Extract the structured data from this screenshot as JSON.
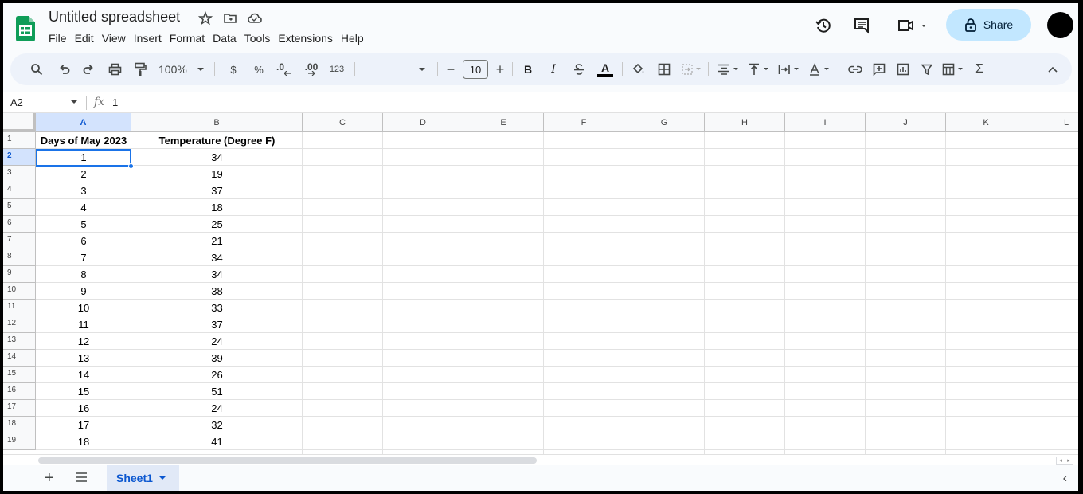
{
  "app": {
    "doc_title": "Untitled spreadsheet",
    "menu": [
      "File",
      "Edit",
      "View",
      "Insert",
      "Format",
      "Data",
      "Tools",
      "Extensions",
      "Help"
    ],
    "share_label": "Share",
    "accent_color": "#0b57d0",
    "share_bg": "#c2e7ff"
  },
  "toolbar": {
    "zoom": "100%",
    "currency": "$",
    "percent": "%",
    "decrease_decimal": ".0",
    "increase_decimal": ".00",
    "more_formats": "123",
    "font_size": "10",
    "minus": "−",
    "plus": "+",
    "bold": "B",
    "italic": "I",
    "text_color_letter": "A",
    "function": "Σ",
    "collapse": "^"
  },
  "formula_bar": {
    "cell_ref": "A2",
    "fx": "fx",
    "content": "1"
  },
  "grid": {
    "columns": [
      "A",
      "B",
      "C",
      "D",
      "E",
      "F",
      "G",
      "H",
      "I",
      "J",
      "K",
      "L"
    ],
    "selected_column": "A",
    "selected_row": "2",
    "row_numbers": [
      "1",
      "2",
      "3",
      "4",
      "5",
      "6",
      "7",
      "8",
      "9",
      "10",
      "11",
      "12",
      "13",
      "14",
      "15",
      "16",
      "17",
      "18",
      "19"
    ],
    "header_row": [
      "Days of May 2023",
      "Temperature (Degree F)"
    ],
    "rows": [
      [
        "1",
        "34"
      ],
      [
        "2",
        "19"
      ],
      [
        "3",
        "37"
      ],
      [
        "4",
        "18"
      ],
      [
        "5",
        "25"
      ],
      [
        "6",
        "21"
      ],
      [
        "7",
        "34"
      ],
      [
        "8",
        "34"
      ],
      [
        "9",
        "38"
      ],
      [
        "10",
        "33"
      ],
      [
        "11",
        "37"
      ],
      [
        "12",
        "24"
      ],
      [
        "13",
        "39"
      ],
      [
        "14",
        "26"
      ],
      [
        "15",
        "51"
      ],
      [
        "16",
        "24"
      ],
      [
        "17",
        "32"
      ],
      [
        "18",
        "41"
      ]
    ],
    "selection_color": "#1a73e8"
  },
  "sheets": {
    "add": "+",
    "tabs": [
      "Sheet1"
    ],
    "active": "Sheet1",
    "collapse": "‹"
  }
}
